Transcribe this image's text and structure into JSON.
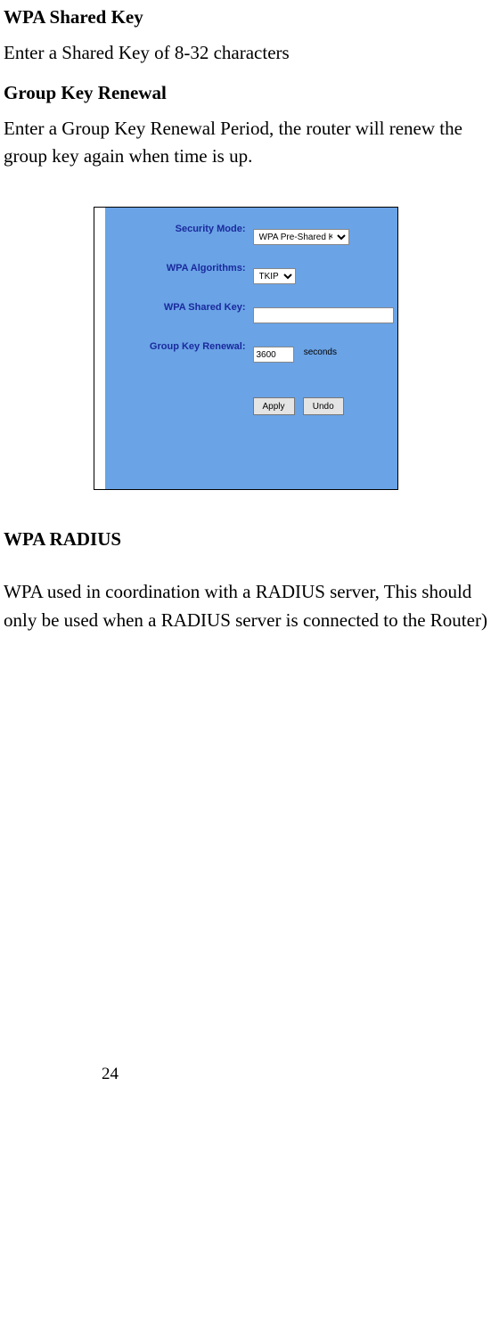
{
  "headings": {
    "wpa_shared_key": "WPA Shared Key",
    "group_key_renewal": "Group Key Renewal",
    "wpa_radius": "WPA RADIUS"
  },
  "paragraphs": {
    "shared_key_desc": "Enter a Shared Key of 8-32 characters",
    "group_key_desc": "Enter a Group Key Renewal Period, the router will renew the group key again when time is up.",
    "wpa_radius_desc": "WPA used in coordination with a RADIUS server, This should only be used when a RADIUS server is connected to the Router)"
  },
  "figure": {
    "labels": {
      "security_mode": "Security Mode:",
      "wpa_algorithms": "WPA Algorithms:",
      "wpa_shared_key": "WPA Shared Key:",
      "group_key_renewal": "Group Key Renewal:",
      "seconds": "seconds"
    },
    "values": {
      "security_mode": "WPA Pre-Shared Key",
      "wpa_algorithms": "TKIP",
      "wpa_shared_key": "",
      "group_key_renewal": "3600"
    },
    "buttons": {
      "apply": "Apply",
      "undo": "Undo"
    }
  },
  "page_number": "24"
}
